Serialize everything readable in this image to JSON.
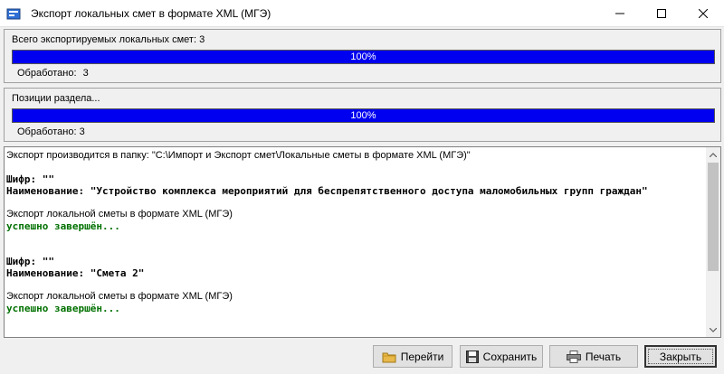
{
  "window": {
    "title": "Экспорт локальных смет в формате XML (МГЭ)",
    "controls": [
      "minimize-icon",
      "maximize-icon",
      "close-icon"
    ]
  },
  "panel_total": {
    "label": "Всего экспортируемых локальных смет: 3",
    "progress_text": "100%",
    "progress_fraction": 1.0,
    "processed_label": "Обработано:",
    "processed_value": "3"
  },
  "panel_positions": {
    "label": "Позиции раздела...",
    "progress_text": "100%",
    "progress_fraction": 1.0,
    "processed_text": "Обработано: 3"
  },
  "log": {
    "lines": [
      "Экспорт производится в папку: \"C:\\Импорт и Экспорт смет\\Локальные сметы в формате XML (МГЭ)\"",
      "Шифр: \"\"",
      "Наименование: \"Устройство комплекса мероприятий для беспрепятственного доступа маломобильных групп граждан\"",
      "Экспорт локальной сметы в формате XML (МГЭ)",
      "успешно завершён...",
      "Шифр: \"\"",
      "Наименование: \"Смета 2\"",
      "Экспорт локальной сметы в формате XML (МГЭ)",
      "успешно завершён..."
    ]
  },
  "buttons": {
    "goto": {
      "label": "Перейти",
      "icon": "folder-icon"
    },
    "save": {
      "label": "Сохранить",
      "icon": "floppy-disk-icon"
    },
    "print": {
      "label": "Печать",
      "icon": "printer-icon"
    },
    "close": {
      "label": "Закрыть"
    }
  },
  "colors": {
    "progress_fill": "#0000f0",
    "success_text": "#007000"
  }
}
